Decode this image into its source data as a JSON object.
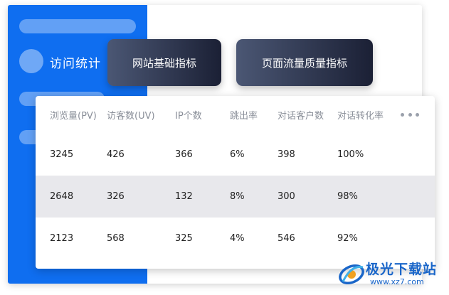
{
  "sidebar": {
    "nav_label": "访问统计"
  },
  "tabs": [
    {
      "label": "网站基础指标"
    },
    {
      "label": "页面流量质量指标"
    }
  ],
  "table": {
    "columns": [
      "浏览量(PV)",
      "访客数(UV)",
      "IP个数",
      "跳出率",
      "对话客户数",
      "对话转化率"
    ],
    "rows": [
      [
        "3245",
        "426",
        "366",
        "6%",
        "398",
        "100%"
      ],
      [
        "2648",
        "326",
        "132",
        "8%",
        "300",
        "98%"
      ],
      [
        "2123",
        "568",
        "325",
        "4%",
        "546",
        "92%"
      ]
    ],
    "more_icon": "more-horizontal-icon"
  },
  "watermark": {
    "brand": "极光下载站",
    "url": "www.xz7.com"
  },
  "colors": {
    "sidebar": "#0f6ef0",
    "tab_gradient_start": "#4b5774",
    "tab_gradient_end": "#1b2035",
    "highlight_row": "#e8e8ec",
    "watermark": "#1a66c9"
  }
}
